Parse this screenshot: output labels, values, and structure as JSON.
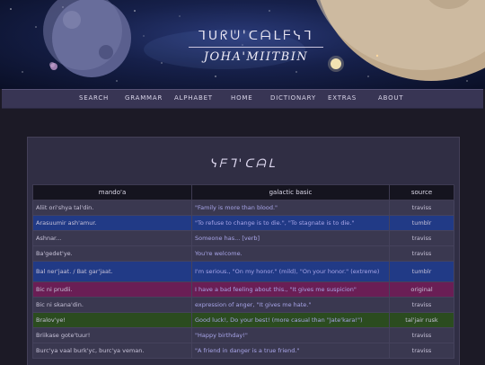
{
  "banner": {
    "script_title": "ᒣᑌᖇᕫ'ᑕᗩᒪᖴᓭᒣ",
    "site_title": "JOHA'MIITBIN"
  },
  "nav": {
    "items": [
      "SEARCH",
      "GRAMMAR",
      "ALPHABET",
      "HOME",
      "DICTIONARY",
      "EXTRAS",
      "ABOUT"
    ]
  },
  "main": {
    "script_heading": "ᓭᖴᒣ'ᑕᗩᒪ",
    "table": {
      "headers": [
        "mando'a",
        "galactic basic",
        "source"
      ],
      "rows": [
        {
          "mando": "Aliit ori'shya tal'din.",
          "basic": "\"Family is more than blood.\"",
          "source": "traviss"
        },
        {
          "mando": "Arasuumir ash'amur.",
          "basic": "\"To refuse to change is to die.\", \"To stagnate is to die.\"",
          "source": "tumblr"
        },
        {
          "mando": "Ashnar...",
          "basic": "Someone has... [verb]",
          "source": "traviss"
        },
        {
          "mando": "Ba'gedet'ye.",
          "basic": "You're welcome.",
          "source": "traviss"
        },
        {
          "mando": "Bal ner'jaat. / Bat gar'jaat.",
          "basic": "I'm serious., \"On my honor.\" (mild), \"On your honor.\" (extreme)",
          "source": "tumblr"
        },
        {
          "mando": "Bic ni prudii.",
          "basic": "I have a bad feeling about this., \"It gives me suspicion\"",
          "source": "original"
        },
        {
          "mando": "Bic ni skana'din.",
          "basic": "expression of anger, \"It gives me hate.\"",
          "source": "traviss"
        },
        {
          "mando": "Bralov'ye!",
          "basic": "Good luck!, Do your best! (more casual than \"Jate'kara!\")",
          "source": "tal'jair rusk"
        },
        {
          "mando": "Briikase gote'tuur!",
          "basic": "\"Happy birthday!\"",
          "source": "traviss"
        },
        {
          "mando": "Burc'ya vaal burk'yc, burc'ya veman.",
          "basic": "\"A friend in danger is a true friend.\"",
          "source": "traviss"
        }
      ]
    }
  },
  "colors": {
    "traviss": "#3a3850",
    "tumblr": "#213a86",
    "original": "#6a1e55",
    "taljair": "#2b4c1f",
    "nav_bg": "#383554",
    "panel_bg": "#302e44"
  }
}
